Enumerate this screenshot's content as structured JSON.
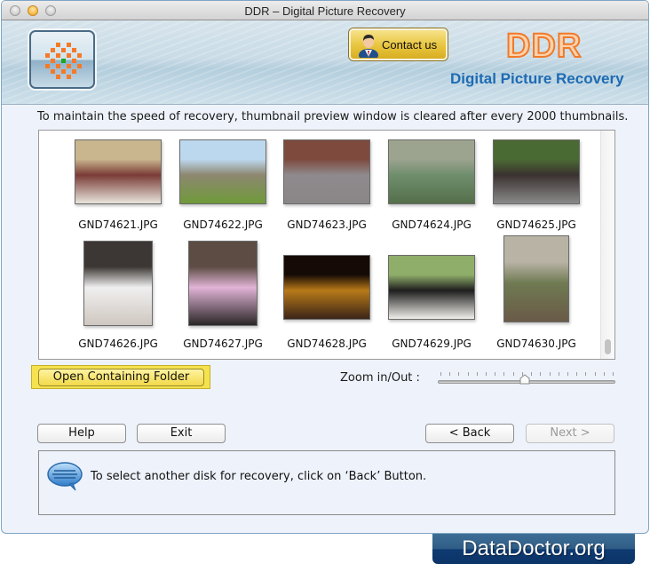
{
  "window": {
    "title": "DDR – Digital Picture Recovery"
  },
  "banner": {
    "logo_icon": "ddr-checker-logo-icon",
    "contact_label": "Contact us",
    "contact_icon": "user-person-icon",
    "brand_name": "DDR",
    "brand_subtitle": "Digital Picture Recovery"
  },
  "notice": "To maintain the speed of recovery, thumbnail preview window is cleared after every 2000 thumbnails.",
  "preview": {
    "thumbnails": [
      {
        "filename": "GND74621.JPG",
        "orientation": "landscape",
        "colors": [
          "#c9b58e",
          "#7a3b36",
          "#e8e5dc"
        ]
      },
      {
        "filename": "GND74622.JPG",
        "orientation": "landscape",
        "colors": [
          "#bcd8ee",
          "#8d8770",
          "#6f9a3a"
        ]
      },
      {
        "filename": "GND74623.JPG",
        "orientation": "landscape",
        "colors": [
          "#7d4a3d",
          "#8f8a8d",
          "#8a8686"
        ]
      },
      {
        "filename": "GND74624.JPG",
        "orientation": "landscape",
        "colors": [
          "#9ca38f",
          "#6f8e6c",
          "#546f4a"
        ]
      },
      {
        "filename": "GND74625.JPG",
        "orientation": "landscape",
        "colors": [
          "#4a6a33",
          "#3a3230",
          "#8a8a8a"
        ]
      },
      {
        "filename": "GND74626.JPG",
        "orientation": "portrait",
        "colors": [
          "#3c3734",
          "#f0efef",
          "#cfc7c0"
        ]
      },
      {
        "filename": "GND74627.JPG",
        "orientation": "portrait",
        "colors": [
          "#5c4c44",
          "#e1b3d6",
          "#2a2626"
        ]
      },
      {
        "filename": "GND74628.JPG",
        "orientation": "landscape",
        "colors": [
          "#150a06",
          "#b87a18",
          "#3b2418"
        ]
      },
      {
        "filename": "GND74629.JPG",
        "orientation": "landscape",
        "colors": [
          "#8fae6a",
          "#1e1e1e",
          "#f0efea"
        ]
      },
      {
        "filename": "GND74630.JPG",
        "orientation": "portrait",
        "colors": [
          "#b9b3a6",
          "#6f7a52",
          "#6a5a48"
        ]
      }
    ],
    "scroll_position": 1.0
  },
  "actions": {
    "open_folder_label": "Open Containing Folder",
    "zoom_label": "Zoom in/Out :",
    "zoom_value": 0.49,
    "zoom_ticks": 20
  },
  "nav": {
    "help_label": "Help",
    "exit_label": "Exit",
    "back_label": "< Back",
    "next_label": "Next >",
    "next_enabled": false
  },
  "message": {
    "icon": "speech-bubble-icon",
    "text": "To select another disk for recovery, click on ‘Back’ Button."
  },
  "footer": {
    "brand": "DataDoctor.org"
  }
}
